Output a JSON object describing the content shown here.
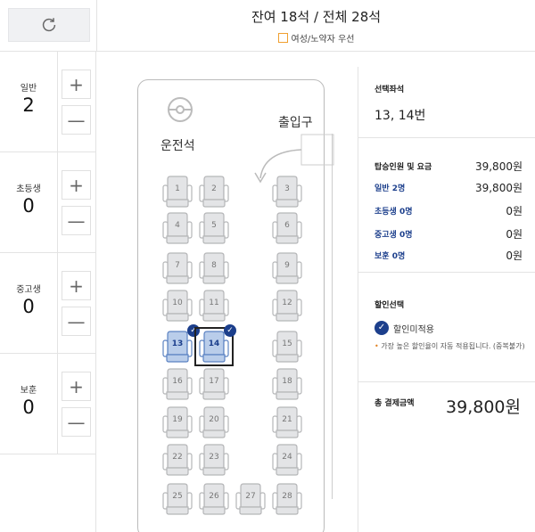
{
  "header": {
    "title": "잔여 18석 / 전체 28석",
    "legend_label": "여성/노약자 우선",
    "legend_color": "#f0a030"
  },
  "toolbar": {
    "refresh_icon": "refresh-icon"
  },
  "passengers": [
    {
      "label": "일반",
      "count": "2"
    },
    {
      "label": "초등생",
      "count": "0"
    },
    {
      "label": "중고생",
      "count": "0"
    },
    {
      "label": "보훈",
      "count": "0"
    }
  ],
  "bus": {
    "driver_label": "운전석",
    "door_label": "출입구",
    "seats": [
      "1",
      "2",
      "3",
      "4",
      "5",
      "6",
      "7",
      "8",
      "9",
      "10",
      "11",
      "12",
      "13",
      "14",
      "15",
      "16",
      "17",
      "18",
      "19",
      "20",
      "21",
      "22",
      "23",
      "24",
      "25",
      "26",
      "27",
      "28"
    ],
    "selected": [
      "13",
      "14"
    ],
    "accent": "#1c3f8c"
  },
  "summary": {
    "selected_title": "선택좌석",
    "selected_value": "13, 14번",
    "fare_rows": [
      {
        "label": "탑승인원 및 요금",
        "value": "39,800원"
      },
      {
        "label": "일반 2명",
        "value": "39,800원"
      },
      {
        "label": "초등생 0명",
        "value": "0원"
      },
      {
        "label": "중고생 0명",
        "value": "0원"
      },
      {
        "label": "보훈 0명",
        "value": "0원"
      }
    ],
    "discount_title": "할인선택",
    "discount_option": "할인미적용",
    "discount_note": "가장 높은 할인율이 자동 적용됩니다. (중복불가)",
    "total_label": "총 결제금액",
    "total_value": "39,800원"
  }
}
